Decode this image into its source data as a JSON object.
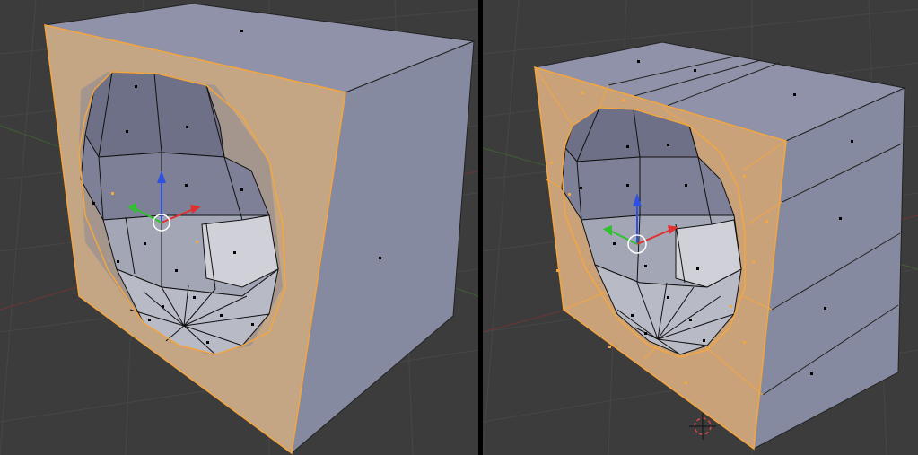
{
  "editor": {
    "left": {
      "name": "viewport-left"
    },
    "right": {
      "name": "viewport-right"
    }
  },
  "colors": {
    "background": "#3c3c3c",
    "grid": "#464646",
    "grid_line_red": "#7a3b3b",
    "grid_line_green": "#4a6a3d",
    "face": "#8f92a8",
    "face_dark": "#6f7288",
    "face_side": "#7d8097",
    "selected_face": "#caa27a",
    "selected_edge": "#f4a640",
    "vertex": "#000000",
    "axis_x": "#e03030",
    "axis_y": "#30c030",
    "axis_z": "#3050e0"
  },
  "icons": {
    "manipulator": "transform-manipulator-icon",
    "pivot": "pivot-circle-icon",
    "cursor": "3d-cursor-icon"
  }
}
